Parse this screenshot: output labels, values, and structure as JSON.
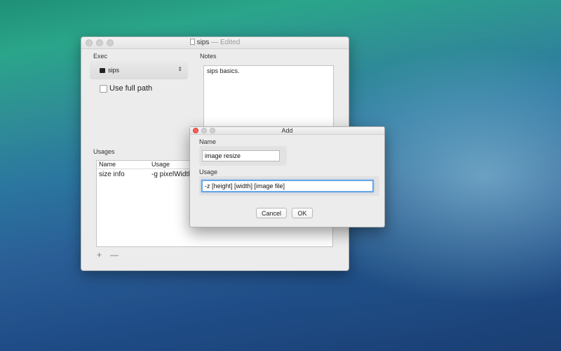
{
  "main_window": {
    "title": "sips",
    "title_status": "— Edited",
    "exec_label": "Exec",
    "exec_value": "sips",
    "use_full_path_label": "Use full path",
    "notes_label": "Notes",
    "notes_text": "sips basics.",
    "usages_label": "Usages",
    "usages_columns": [
      "Name",
      "Usage"
    ],
    "usages_rows": [
      {
        "name": "size info",
        "usage": "-g pixelWidth -"
      }
    ],
    "add_label": "+",
    "remove_label": "—"
  },
  "add_sheet": {
    "title": "Add",
    "name_label": "Name",
    "name_value": "image resize",
    "usage_label": "Usage",
    "usage_value": "-z [height] [width] [image file]",
    "cancel_label": "Cancel",
    "ok_label": "OK"
  }
}
